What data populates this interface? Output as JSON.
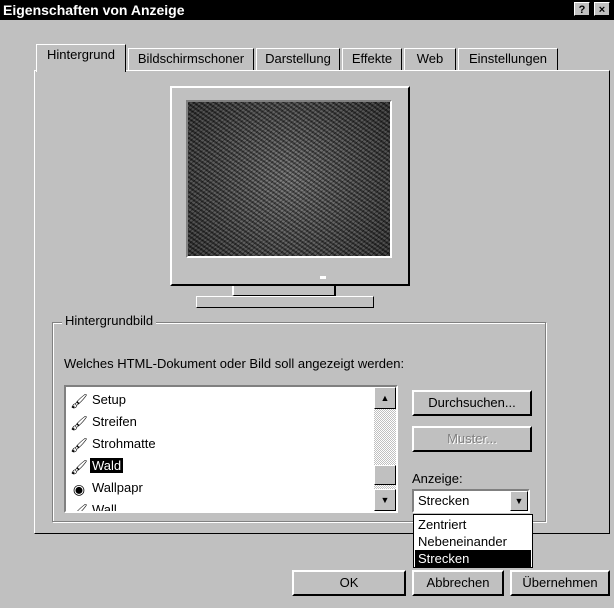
{
  "window": {
    "title": "Eigenschaften von Anzeige",
    "help_glyph": "?",
    "close_glyph": "×"
  },
  "tabs": [
    {
      "label": "Hintergrund",
      "active": true
    },
    {
      "label": "Bildschirmschoner",
      "active": false
    },
    {
      "label": "Darstellung",
      "active": false
    },
    {
      "label": "Effekte",
      "active": false
    },
    {
      "label": "Web",
      "active": false
    },
    {
      "label": "Einstellungen",
      "active": false
    }
  ],
  "wallpaper_group": {
    "legend": "Hintergrundbild",
    "question": "Welches HTML-Dokument oder Bild soll angezeigt werden:",
    "items": [
      {
        "label": "Setup",
        "icon": "paint-icon",
        "selected": false
      },
      {
        "label": "Streifen",
        "icon": "paint-icon",
        "selected": false
      },
      {
        "label": "Strohmatte",
        "icon": "paint-icon",
        "selected": false
      },
      {
        "label": "Wald",
        "icon": "paint-icon",
        "selected": true
      },
      {
        "label": "Wallpapr",
        "icon": "html-icon",
        "selected": false
      },
      {
        "label": "Wall...",
        "icon": "paint-icon",
        "selected": false
      }
    ],
    "browse_button": "Durchsuchen...",
    "pattern_button": "Muster...",
    "display_label": "Anzeige:",
    "display_value": "Strecken",
    "display_options": [
      {
        "label": "Zentriert",
        "selected": false
      },
      {
        "label": "Nebeneinander",
        "selected": false
      },
      {
        "label": "Strecken",
        "selected": true
      }
    ]
  },
  "footer": {
    "ok": "OK",
    "cancel": "Abbrechen",
    "apply": "Übernehmen"
  },
  "colors": {
    "face": "#c0c0c0",
    "titlebar": "#000000",
    "highlight": "#000000"
  }
}
